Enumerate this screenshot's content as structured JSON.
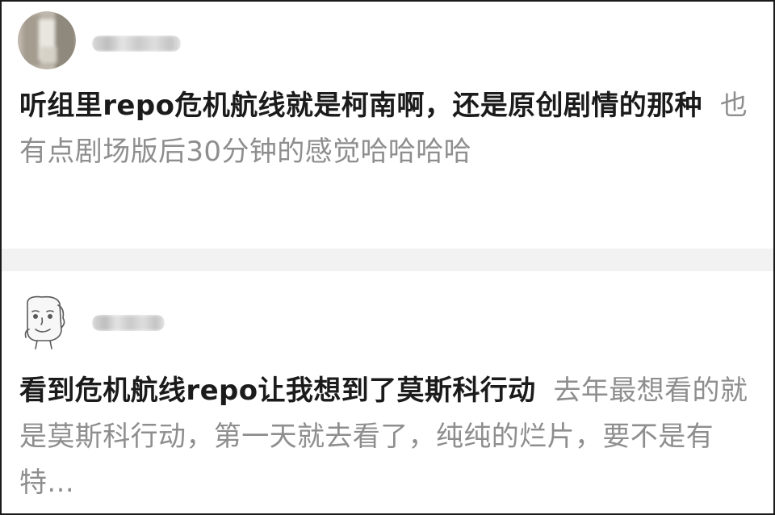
{
  "posts": [
    {
      "bold_text": "听组里repo危机航线就是柯南啊，还是原创剧情的那种",
      "gray_text": "也有点剧场版后30分钟的感觉哈哈哈哈"
    },
    {
      "bold_text": "看到危机航线repo让我想到了莫斯科行动",
      "gray_text": "去年最想看的就是莫斯科行动，第一天就去看了，纯纯的烂片，要不是有特..."
    }
  ],
  "icons": {
    "post_1_avatar": "blurred-photo-avatar",
    "post_2_avatar": "cartoon-face-avatar"
  },
  "colors": {
    "bold_text": "#1b1b1b",
    "gray_text": "#8e8e8e",
    "divider": "#f2f2f2",
    "border": "#1a1a1a"
  }
}
